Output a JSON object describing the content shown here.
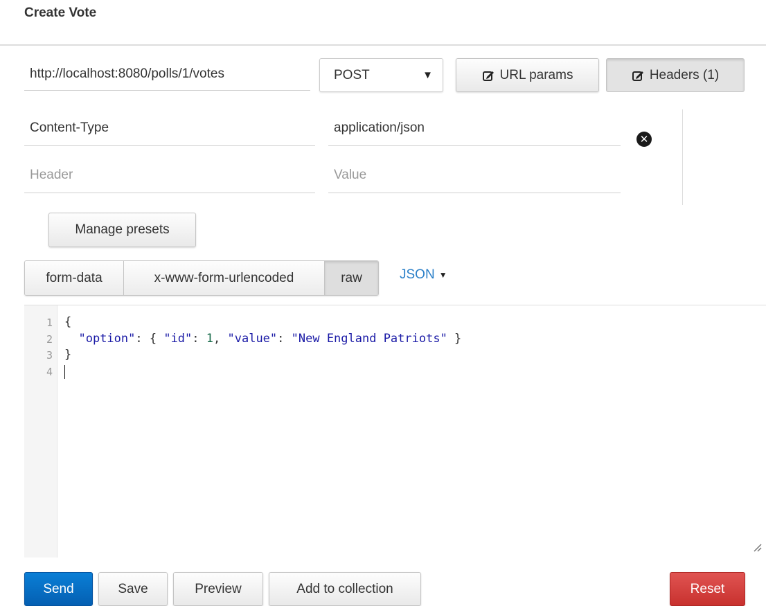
{
  "page": {
    "title": "Create Vote"
  },
  "request": {
    "url": "http://localhost:8080/polls/1/votes",
    "method": "POST",
    "url_params_label": "URL params",
    "headers_label": "Headers (1)"
  },
  "headers": {
    "rows": [
      {
        "key": "Content-Type",
        "value": "application/json"
      }
    ],
    "new_key_placeholder": "Header",
    "new_value_placeholder": "Value",
    "remove_icon": "remove-circle-icon"
  },
  "presets": {
    "manage_label": "Manage presets"
  },
  "body": {
    "tabs": [
      "form-data",
      "x-www-form-urlencoded",
      "raw"
    ],
    "active_tab": "raw",
    "format": "JSON",
    "line_numbers": [
      "1",
      "2",
      "3",
      "4"
    ],
    "code": {
      "l1": "{",
      "l2_key": "\"option\"",
      "l2_mid1": ": { ",
      "l2_idkey": "\"id\"",
      "l2_mid2": ": ",
      "l2_id": "1",
      "l2_mid3": ", ",
      "l2_valkey": "\"value\"",
      "l2_mid4": ": ",
      "l2_val": "\"New England Patriots\"",
      "l2_end": " }",
      "l3": "}"
    }
  },
  "actions": {
    "send": "Send",
    "save": "Save",
    "preview": "Preview",
    "add_to_collection": "Add to collection",
    "reset": "Reset"
  },
  "colors": {
    "send": "#045fb2",
    "reset": "#c8312e",
    "json_link": "#2a7fc8"
  }
}
